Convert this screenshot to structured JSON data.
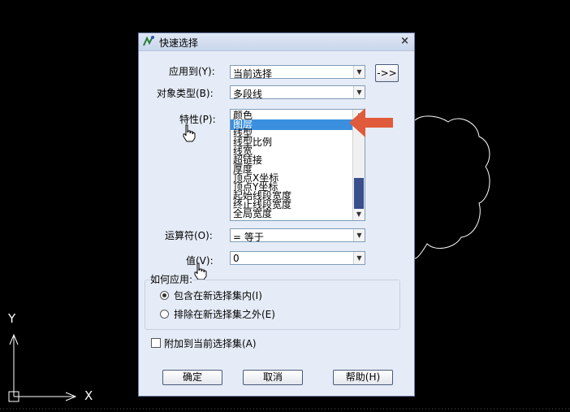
{
  "dialog": {
    "title": "快速选择",
    "close_glyph": "×",
    "apply_to": {
      "label": "应用到(Y):",
      "value": "当前选择"
    },
    "select_objects_button": "->>",
    "object_type": {
      "label": "对象类型(B):",
      "value": "多段线"
    },
    "properties": {
      "label": "特性(P):",
      "items": [
        "颜色",
        "图层",
        "线型",
        "线型比例",
        "线宽",
        "超链接",
        "厚度",
        "顶点X坐标",
        "顶点Y坐标",
        "起始线段宽度",
        "终止线段宽度",
        "全局宽度"
      ],
      "selected_index": 1
    },
    "operator": {
      "label": "运算符(O):",
      "value": "= 等于"
    },
    "value": {
      "label": "值(V):",
      "value": "0"
    },
    "how_to_apply": {
      "label": "如何应用:",
      "options": [
        {
          "label": "包含在新选择集内(I)",
          "checked": true
        },
        {
          "label": "排除在新选择集之外(E)",
          "checked": false
        }
      ]
    },
    "append_checkbox": {
      "label": "附加到当前选择集(A)",
      "checked": false
    },
    "buttons": {
      "ok": "确定",
      "cancel": "取消",
      "help": "帮助(H)"
    }
  },
  "canvas": {
    "axis_x": "X",
    "axis_y": "Y"
  },
  "colors": {
    "arrow": "#e05b3b",
    "selection": "#3a8fde",
    "background": "#000000"
  }
}
